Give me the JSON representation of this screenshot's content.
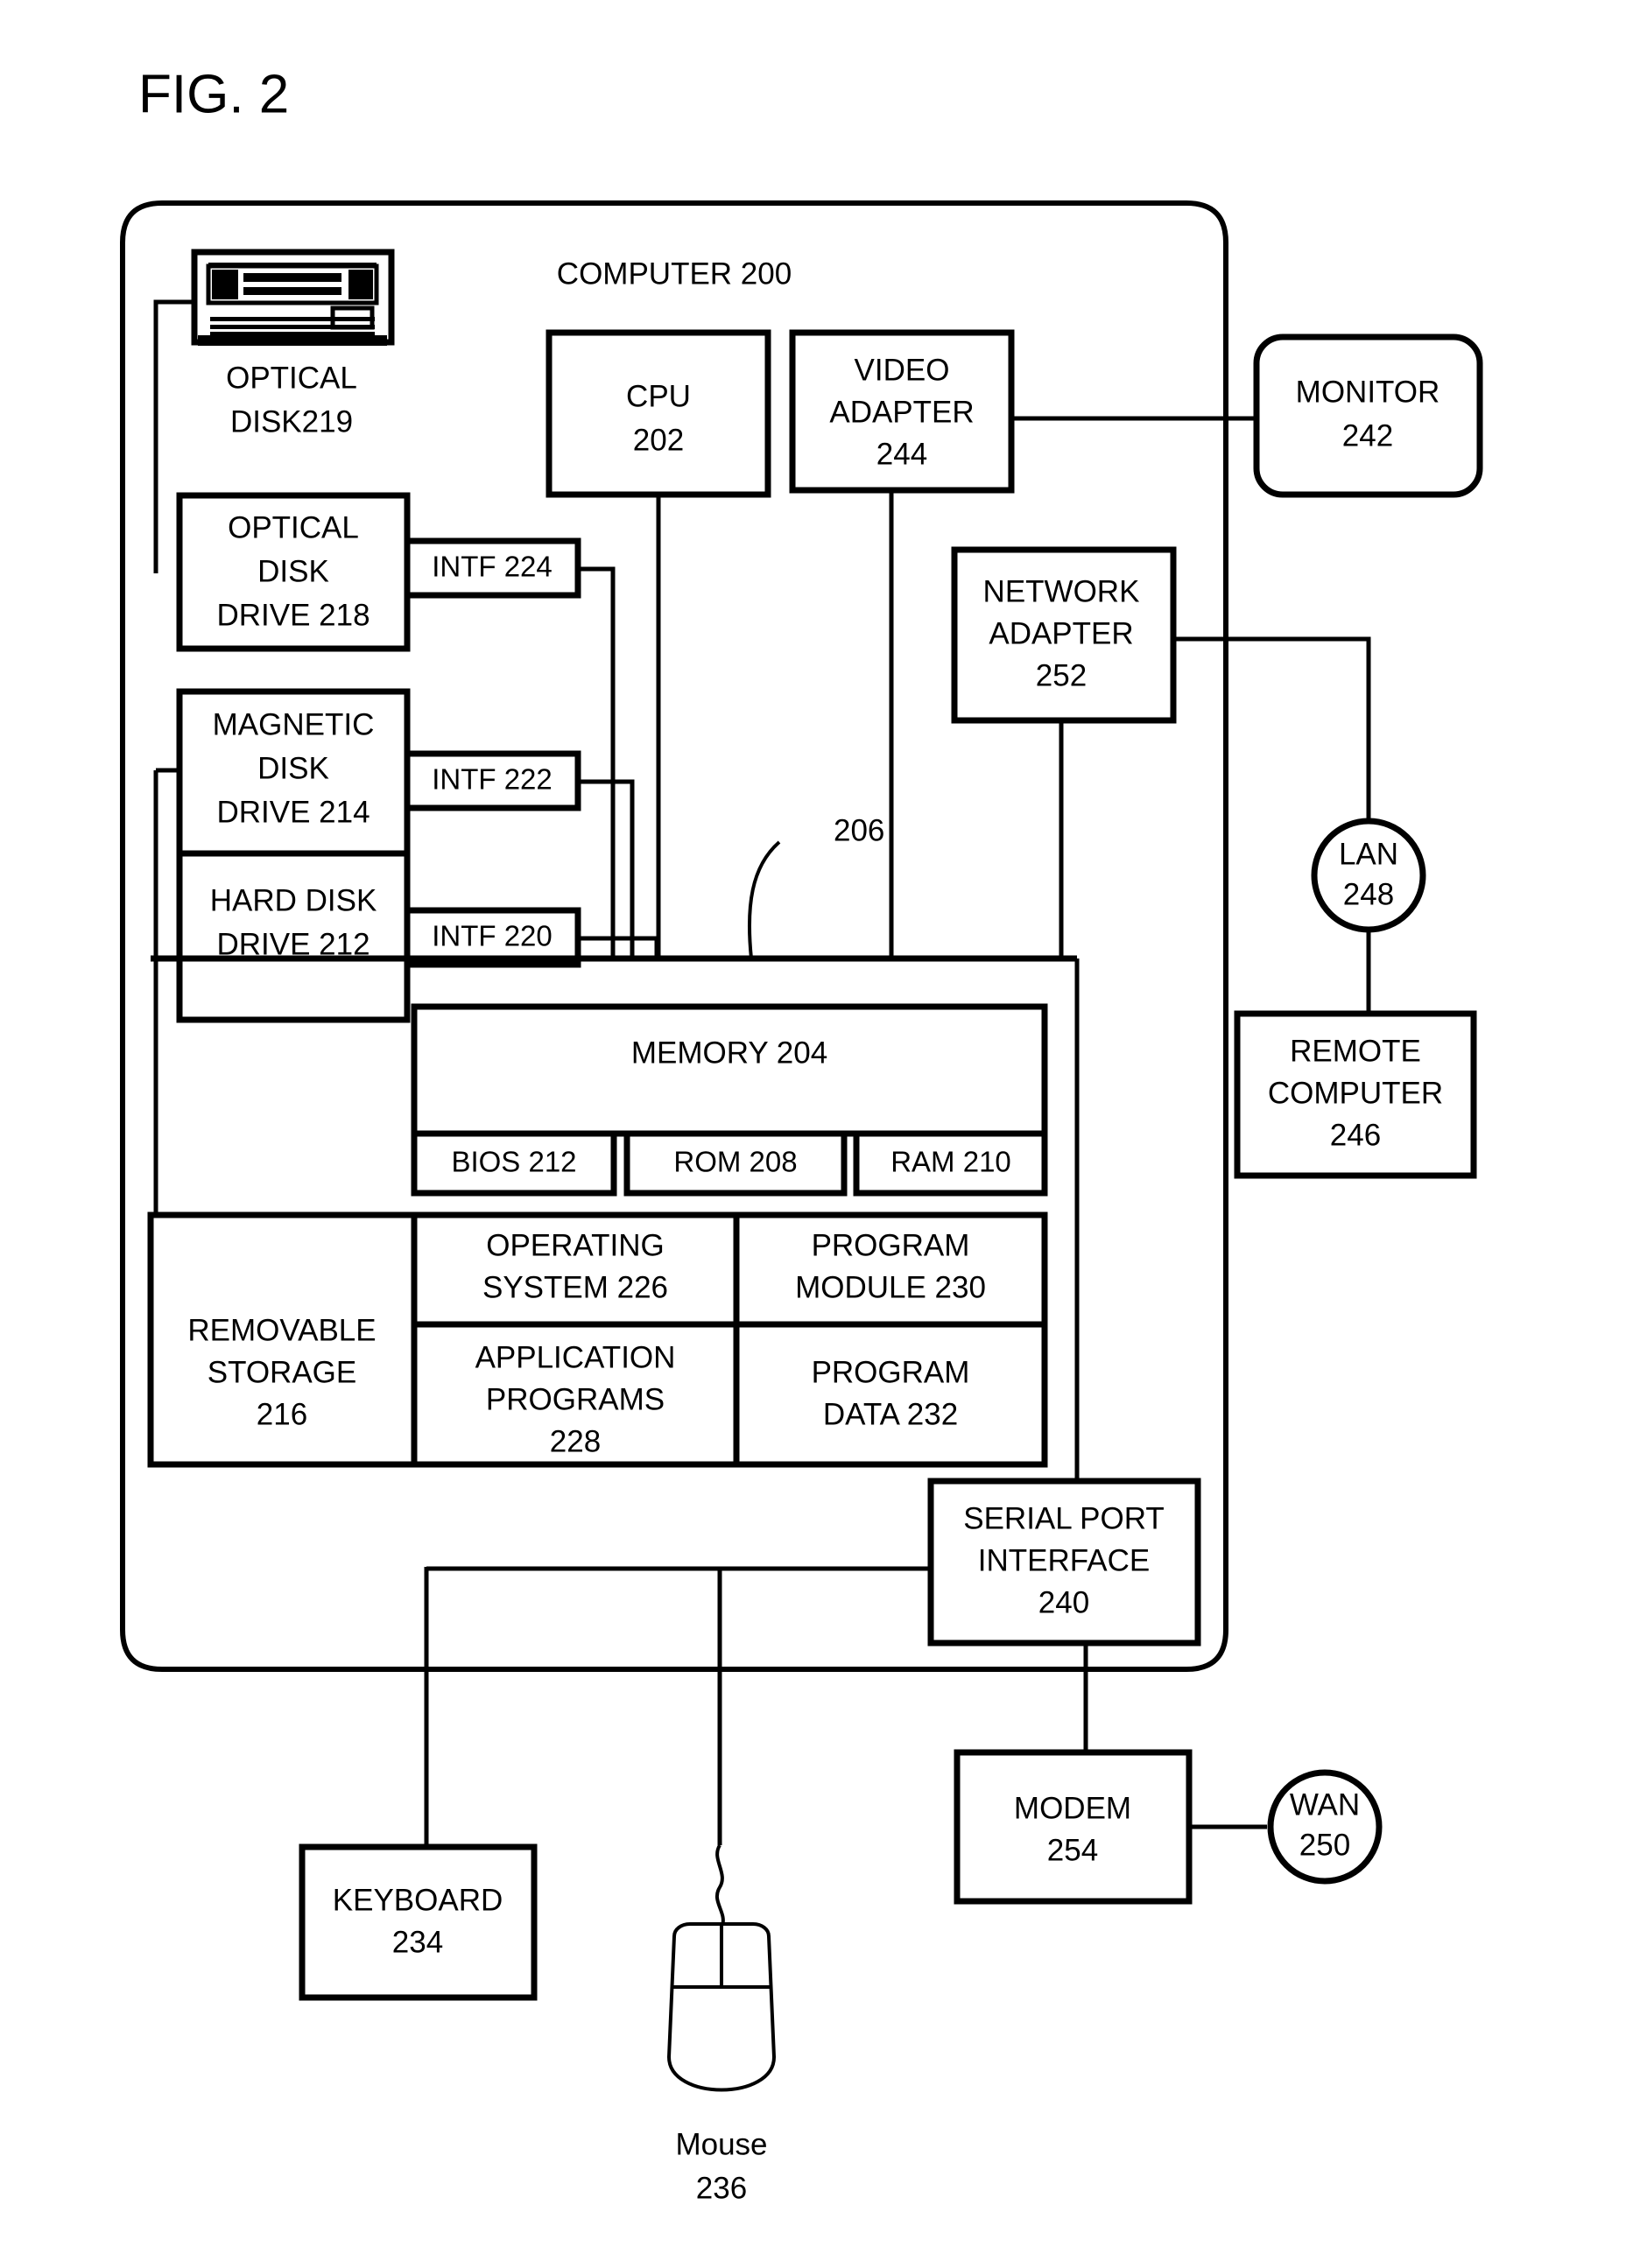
{
  "figure": {
    "title": "FIG. 2",
    "computer_label": "COMPUTER 200",
    "bus_label": "206"
  },
  "nodes": {
    "optical_disk_caption": {
      "line1": "OPTICAL",
      "line2": "DISK219"
    },
    "optical_disk_drive": {
      "line1": "OPTICAL",
      "line2": "DISK",
      "line3": "DRIVE 218"
    },
    "magnetic_disk_drive": {
      "line1": "MAGNETIC",
      "line2": "DISK",
      "line3": "DRIVE 214"
    },
    "hard_disk_drive": {
      "line1": "HARD DISK",
      "line2": "DRIVE 212"
    },
    "intf_224": {
      "label": "INTF 224"
    },
    "intf_222": {
      "label": "INTF 222"
    },
    "intf_220": {
      "label": "INTF 220"
    },
    "cpu": {
      "line1": "CPU",
      "line2": "202"
    },
    "video_adapter": {
      "line1": "VIDEO",
      "line2": "ADAPTER",
      "line3": "244"
    },
    "monitor": {
      "line1": "MONITOR",
      "line2": "242"
    },
    "network_adapter": {
      "line1": "NETWORK",
      "line2": "ADAPTER",
      "line3": "252"
    },
    "lan": {
      "line1": "LAN",
      "line2": "248"
    },
    "remote_computer": {
      "line1": "REMOTE",
      "line2": "COMPUTER",
      "line3": "246"
    },
    "memory": {
      "label": "MEMORY 204"
    },
    "bios": {
      "label": "BIOS 212"
    },
    "rom": {
      "label": "ROM 208"
    },
    "ram": {
      "label": "RAM 210"
    },
    "operating_system": {
      "line1": "OPERATING",
      "line2": "SYSTEM 226"
    },
    "program_module": {
      "line1": "PROGRAM",
      "line2": "MODULE 230"
    },
    "application_programs": {
      "line1": "APPLICATION",
      "line2": "PROGRAMS",
      "line3": "228"
    },
    "program_data": {
      "line1": "PROGRAM",
      "line2": "DATA 232"
    },
    "removable_storage": {
      "line1": "REMOVABLE",
      "line2": "STORAGE",
      "line3": "216"
    },
    "serial_port_interface": {
      "line1": "SERIAL PORT",
      "line2": "INTERFACE",
      "line3": "240"
    },
    "modem": {
      "line1": "MODEM",
      "line2": "254"
    },
    "wan": {
      "line1": "WAN",
      "line2": "250"
    },
    "keyboard": {
      "line1": "KEYBOARD",
      "line2": "234"
    },
    "mouse": {
      "line1": "Mouse",
      "line2": "236"
    }
  },
  "colors": {
    "ink": "#000000",
    "paper": "#ffffff"
  }
}
